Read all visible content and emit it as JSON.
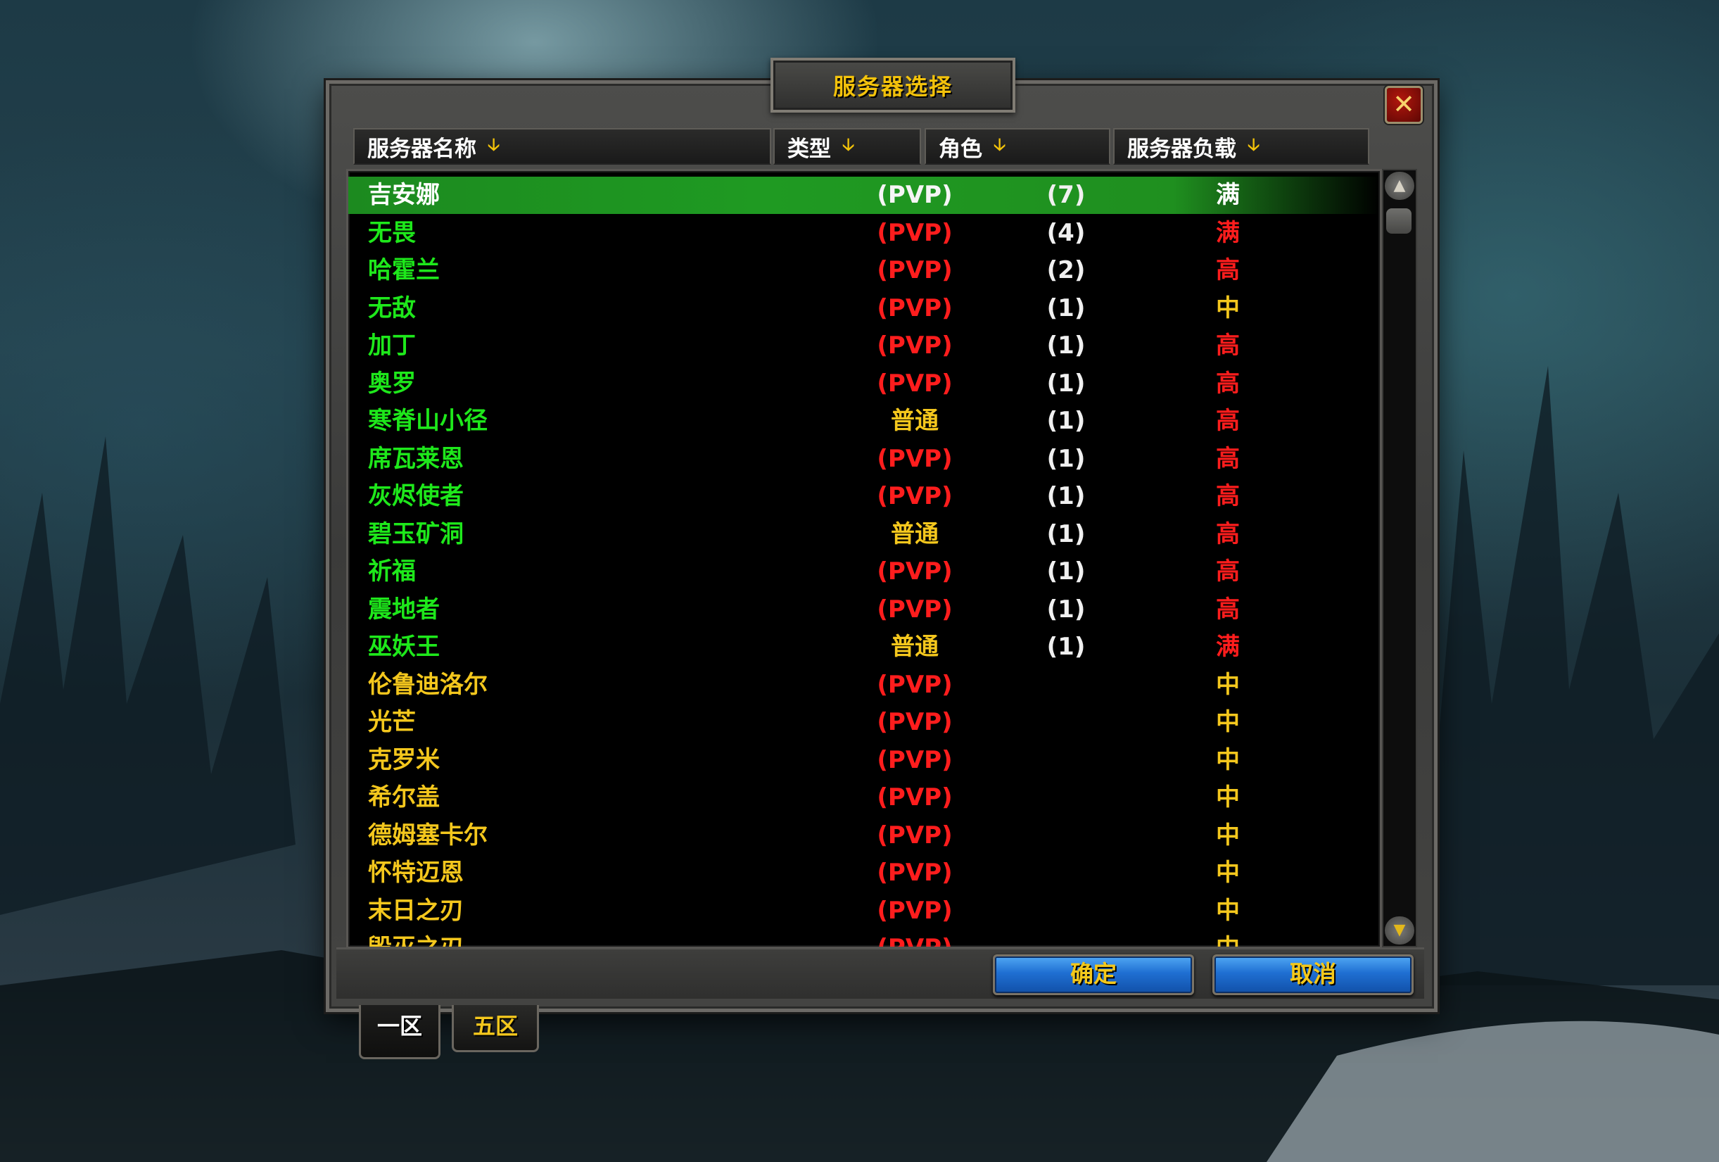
{
  "dialog": {
    "title": "服务器选择",
    "close_icon": "✕",
    "columns": {
      "name": "服务器名称",
      "type": "类型",
      "characters": "角色",
      "load": "服务器负载",
      "sort_icon": "🡣"
    },
    "scroll": {
      "up_icon": "▲",
      "down_icon": "▼"
    },
    "buttons": {
      "ok": "确定",
      "cancel": "取消"
    },
    "tabs": [
      {
        "label": "一区",
        "active": true
      },
      {
        "label": "五区",
        "active": false
      }
    ]
  },
  "servers": [
    {
      "name": "吉安娜",
      "type": "(PVP)",
      "characters": "(7)",
      "load": "满",
      "name_color": "white",
      "type_color": "pvpwhite",
      "load_color": "white",
      "selected": true
    },
    {
      "name": "无畏",
      "type": "(PVP)",
      "characters": "(4)",
      "load": "满",
      "name_color": "green",
      "type_color": "red",
      "load_color": "red"
    },
    {
      "name": "哈霍兰",
      "type": "(PVP)",
      "characters": "(2)",
      "load": "高",
      "name_color": "green",
      "type_color": "red",
      "load_color": "red"
    },
    {
      "name": "无敌",
      "type": "(PVP)",
      "characters": "(1)",
      "load": "中",
      "name_color": "green",
      "type_color": "red",
      "load_color": "yellow"
    },
    {
      "name": "加丁",
      "type": "(PVP)",
      "characters": "(1)",
      "load": "高",
      "name_color": "green",
      "type_color": "red",
      "load_color": "red"
    },
    {
      "name": "奥罗",
      "type": "(PVP)",
      "characters": "(1)",
      "load": "高",
      "name_color": "green",
      "type_color": "red",
      "load_color": "red"
    },
    {
      "name": "寒脊山小径",
      "type": "普通",
      "characters": "(1)",
      "load": "高",
      "name_color": "green",
      "type_color": "yellow",
      "load_color": "red"
    },
    {
      "name": "席瓦莱恩",
      "type": "(PVP)",
      "characters": "(1)",
      "load": "高",
      "name_color": "green",
      "type_color": "red",
      "load_color": "red"
    },
    {
      "name": "灰烬使者",
      "type": "(PVP)",
      "characters": "(1)",
      "load": "高",
      "name_color": "green",
      "type_color": "red",
      "load_color": "red"
    },
    {
      "name": "碧玉矿洞",
      "type": "普通",
      "characters": "(1)",
      "load": "高",
      "name_color": "green",
      "type_color": "yellow",
      "load_color": "red"
    },
    {
      "name": "祈福",
      "type": "(PVP)",
      "characters": "(1)",
      "load": "高",
      "name_color": "green",
      "type_color": "red",
      "load_color": "red"
    },
    {
      "name": "震地者",
      "type": "(PVP)",
      "characters": "(1)",
      "load": "高",
      "name_color": "green",
      "type_color": "red",
      "load_color": "red"
    },
    {
      "name": "巫妖王",
      "type": "普通",
      "characters": "(1)",
      "load": "满",
      "name_color": "green",
      "type_color": "yellow",
      "load_color": "red"
    },
    {
      "name": "伦鲁迪洛尔",
      "type": "(PVP)",
      "characters": "",
      "load": "中",
      "name_color": "yellow",
      "type_color": "red",
      "load_color": "yellow"
    },
    {
      "name": "光芒",
      "type": "(PVP)",
      "characters": "",
      "load": "中",
      "name_color": "yellow",
      "type_color": "red",
      "load_color": "yellow"
    },
    {
      "name": "克罗米",
      "type": "(PVP)",
      "characters": "",
      "load": "中",
      "name_color": "yellow",
      "type_color": "red",
      "load_color": "yellow"
    },
    {
      "name": "希尔盖",
      "type": "(PVP)",
      "characters": "",
      "load": "中",
      "name_color": "yellow",
      "type_color": "red",
      "load_color": "yellow"
    },
    {
      "name": "德姆塞卡尔",
      "type": "(PVP)",
      "characters": "",
      "load": "中",
      "name_color": "yellow",
      "type_color": "red",
      "load_color": "yellow"
    },
    {
      "name": "怀特迈恩",
      "type": "(PVP)",
      "characters": "",
      "load": "中",
      "name_color": "yellow",
      "type_color": "red",
      "load_color": "yellow"
    },
    {
      "name": "末日之刃",
      "type": "(PVP)",
      "characters": "",
      "load": "中",
      "name_color": "yellow",
      "type_color": "red",
      "load_color": "yellow"
    },
    {
      "name": "毁灭之刃",
      "type": "(PVP)",
      "characters": "",
      "load": "中",
      "name_color": "yellow",
      "type_color": "red",
      "load_color": "yellow"
    }
  ]
}
